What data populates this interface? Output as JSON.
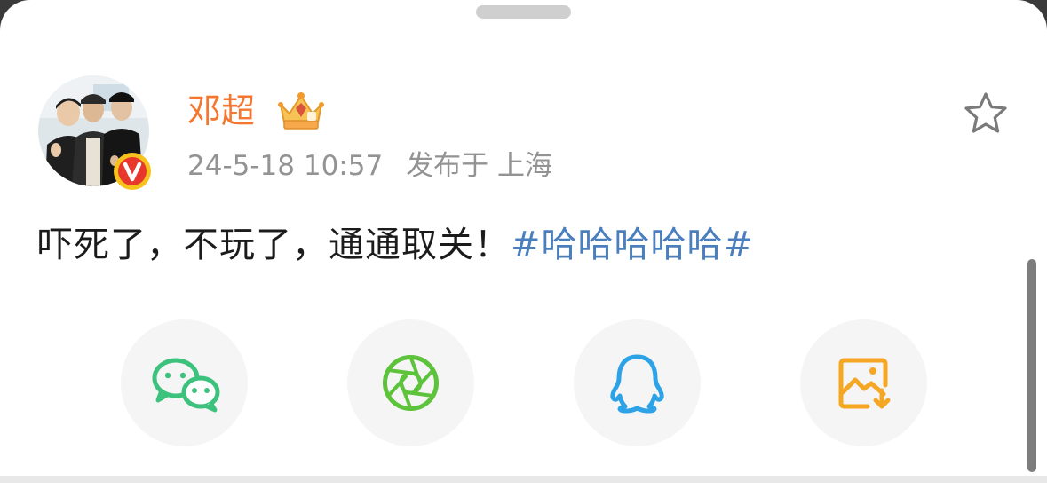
{
  "sheet": {
    "grabber": "drag-handle"
  },
  "post": {
    "author_name": "邓超",
    "author_badge_icon": "crown-badge-icon",
    "verified_icon": "verified-v-icon",
    "timestamp": "24-5-18 10:57",
    "location": "发布于 上海",
    "text": "吓死了，不玩了，通通取关！",
    "hashtag": "#哈哈哈哈哈#",
    "favorite_icon": "star-outline-icon"
  },
  "share_targets": [
    {
      "icon": "wechat-icon",
      "color": "#3dc27d"
    },
    {
      "icon": "moments-icon",
      "color": "#5cc33b"
    },
    {
      "icon": "qq-icon",
      "color": "#2ea2e6"
    },
    {
      "icon": "save-image-icon",
      "color": "#f5a623"
    }
  ],
  "colors": {
    "author": "#f5772f",
    "hashtag": "#4a7fbe",
    "meta": "#939393"
  }
}
